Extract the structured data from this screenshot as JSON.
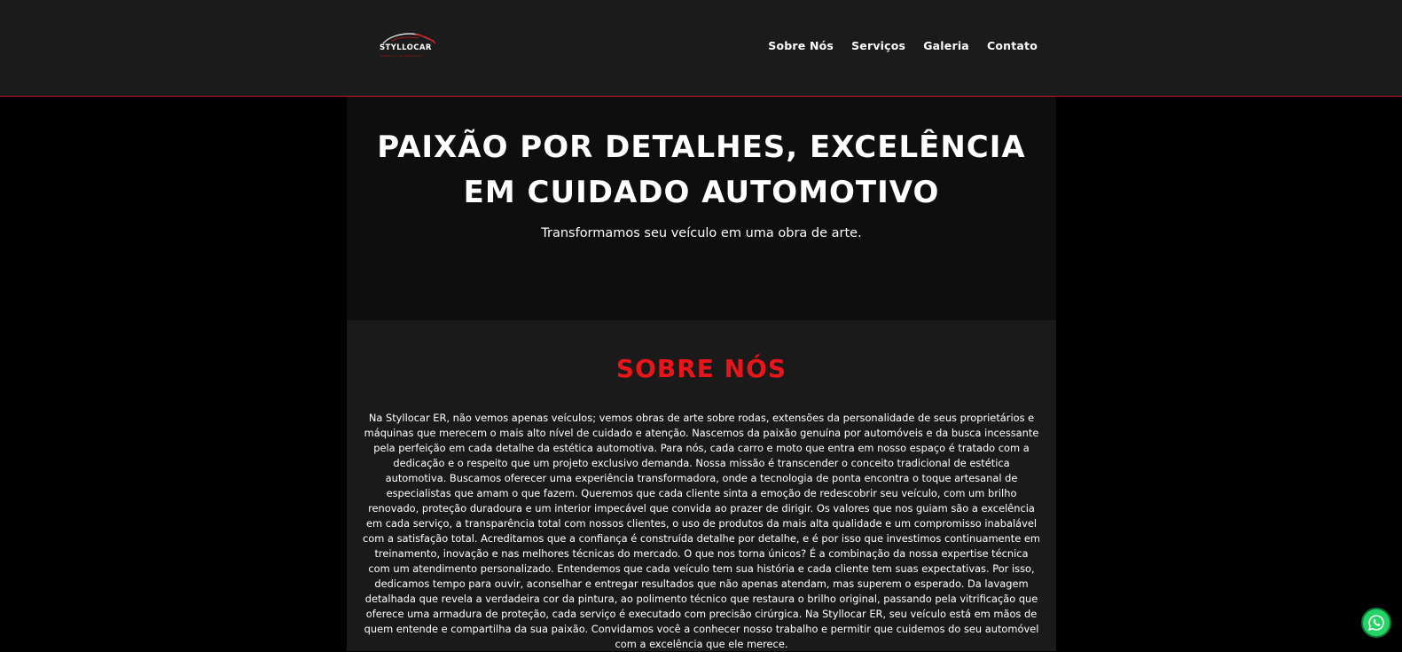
{
  "header": {
    "logo": {
      "name": "STYLLOCAR",
      "tagline": "ESTÉTICA AUTOMOTIVA",
      "icon": "car-silhouette-icon"
    },
    "nav": [
      {
        "label": "Sobre Nós"
      },
      {
        "label": "Serviços"
      },
      {
        "label": "Galeria"
      },
      {
        "label": "Contato"
      }
    ]
  },
  "hero": {
    "title_line1": "PAIXÃO POR DETALHES, EXCELÊNCIA",
    "title_line2": "EM CUIDADO AUTOMOTIVO",
    "subtitle": "Transformamos seu veículo em uma obra de arte."
  },
  "about": {
    "heading": "SOBRE NÓS",
    "body": "Na Styllocar ER, não vemos apenas veículos; vemos obras de arte sobre rodas, extensões da personalidade de seus proprietários e máquinas que merecem o mais alto nível de cuidado e atenção. Nascemos da paixão genuína por automóveis e da busca incessante pela perfeição em cada detalhe da estética automotiva. Para nós, cada carro e moto que entra em nosso espaço é tratado com a dedicação e o respeito que um projeto exclusivo demanda. Nossa missão é transcender o conceito tradicional de estética automotiva. Buscamos oferecer uma experiência transformadora, onde a tecnologia de ponta encontra o toque artesanal de especialistas que amam o que fazem. Queremos que cada cliente sinta a emoção de redescobrir seu veículo, com um brilho renovado, proteção duradoura e um interior impecável que convida ao prazer de dirigir. Os valores que nos guiam são a excelência em cada serviço, a transparência total com nossos clientes, o uso de produtos da mais alta qualidade e um compromisso inabalável com a satisfação total. Acreditamos que a confiança é construída detalhe por detalhe, e é por isso que investimos continuamente em treinamento, inovação e nas melhores técnicas do mercado. O que nos torna únicos? É a combinação da nossa expertise técnica com um atendimento personalizado. Entendemos que cada veículo tem sua história e cada cliente tem suas expectativas. Por isso, dedicamos tempo para ouvir, aconselhar e entregar resultados que não apenas atendam, mas superem o esperado. Da lavagem detalhada que revela a verdadeira cor da pintura, ao polimento técnico que restaura o brilho original, passando pela vitrificação que oferece uma armadura de proteção, cada serviço é executado com precisão cirúrgica. Na Styllocar ER, seu veículo está em mãos de quem entende e compartilha da sua paixão. Convidamos você a conhecer nosso trabalho e permitir que cuidemos do seu automóvel com a excelência que ele merece."
  },
  "whatsapp": {
    "icon": "whatsapp-icon",
    "color": "#25d366"
  },
  "colors": {
    "accent": "#e8151b",
    "header_bg": "#1b1b1b",
    "hero_bg": "#0e0e0e",
    "section_bg": "#1a1a1a",
    "page_bg": "#000000"
  }
}
